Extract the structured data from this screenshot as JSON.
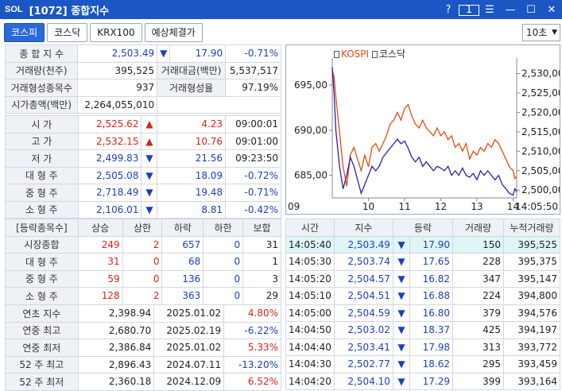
{
  "window": {
    "logo": "SOL",
    "title": "[1072] 종합지수",
    "help": "?",
    "box": "1"
  },
  "tabs": [
    "코스피",
    "코스닥",
    "KRX100",
    "예상체결가"
  ],
  "period": "10초",
  "summary": {
    "r1": {
      "label": "종 합 지 수",
      "value": "2,503.49",
      "arrow": "▼",
      "change": "17.90",
      "pct": "-0.71%"
    },
    "r2": {
      "label": "거래량(천주)",
      "value": "395,525",
      "label2": "거래대금(백만)",
      "value2": "5,537,517"
    },
    "r3": {
      "label": "거래형성종목수",
      "value": "937",
      "label2": "거래형성율",
      "value2": "97.19%"
    },
    "r4": {
      "label": "시가총액(백만)",
      "value": "2,264,055,010"
    }
  },
  "prices": [
    {
      "label": "시      가",
      "value": "2,525.62",
      "arrow": "▲",
      "change": "4.23",
      "extra": "09:00:01"
    },
    {
      "label": "고      가",
      "value": "2,532.15",
      "arrow": "▲",
      "change": "10.76",
      "extra": "09:01:00"
    },
    {
      "label": "저      가",
      "value": "2,499.83",
      "arrow": "▼",
      "change": "21.56",
      "extra": "09:23:50"
    },
    {
      "label": "대 형 주",
      "value": "2,505.08",
      "arrow": "▼",
      "change": "18.09",
      "extra": "-0.72%"
    },
    {
      "label": "중 형 주",
      "value": "2,718.49",
      "arrow": "▼",
      "change": "19.48",
      "extra": "-0.71%"
    },
    {
      "label": "소 형 주",
      "value": "2,106.01",
      "arrow": "▼",
      "change": "8.81",
      "extra": "-0.42%"
    }
  ],
  "breadth": {
    "headers": [
      "[등락종목수]",
      "상승",
      "상한",
      "하락",
      "하한",
      "보합"
    ],
    "rows": [
      [
        "시장종합",
        "249",
        "2",
        "657",
        "0",
        "31"
      ],
      [
        "대 형 주",
        "31",
        "0",
        "68",
        "0",
        "1"
      ],
      [
        "중 형 주",
        "59",
        "0",
        "136",
        "0",
        "3"
      ],
      [
        "소 형 주",
        "128",
        "2",
        "363",
        "0",
        "29"
      ]
    ]
  },
  "yearly": [
    {
      "label": "연초  지수",
      "value": "2,398.94",
      "date": "2025.01.02",
      "pct": "4.80%"
    },
    {
      "label": "연중  최고",
      "value": "2,680.70",
      "date": "2025.02.19",
      "pct": "-6.22%"
    },
    {
      "label": "연중  최저",
      "value": "2,386.84",
      "date": "2025.01.02",
      "pct": "5.33%"
    },
    {
      "label": "52 주 최고",
      "value": "2,896.43",
      "date": "2024.07.11",
      "pct": "-13.20%"
    },
    {
      "label": "52 주 최저",
      "value": "2,360.18",
      "date": "2024.12.09",
      "pct": "6.52%"
    }
  ],
  "ticks": {
    "headers": [
      "시간",
      "지수",
      "등락",
      "거래량",
      "누적거래량"
    ],
    "rows": [
      [
        "14:05:40",
        "2,503.49",
        "▼",
        "17.90",
        "150",
        "395,525"
      ],
      [
        "14:05:30",
        "2,503.74",
        "▼",
        "17.65",
        "228",
        "395,375"
      ],
      [
        "14:05:20",
        "2,504.57",
        "▼",
        "16.82",
        "347",
        "395,147"
      ],
      [
        "14:05:10",
        "2,504.51",
        "▼",
        "16.88",
        "224",
        "394,800"
      ],
      [
        "14:05:00",
        "2,504.59",
        "▼",
        "16.80",
        "379",
        "394,576"
      ],
      [
        "14:04:50",
        "2,503.02",
        "▼",
        "18.37",
        "425",
        "394,197"
      ],
      [
        "14:04:40",
        "2,503.41",
        "▼",
        "17.98",
        "313",
        "393,772"
      ],
      [
        "14:04:30",
        "2,502.77",
        "▼",
        "18.62",
        "295",
        "393,459"
      ],
      [
        "14:04:20",
        "2,504.10",
        "▼",
        "17.29",
        "399",
        "393,164"
      ]
    ]
  },
  "chart_data": {
    "type": "line",
    "legend": [
      "KOSPI",
      "코스닥"
    ],
    "x_ticks": [
      "09",
      "10",
      "11",
      "12",
      "13",
      "14",
      "14:05:50"
    ],
    "left_axis": {
      "ticks": [
        "695,00",
        "690,00",
        "685,00"
      ],
      "range": [
        682.5,
        698.0
      ]
    },
    "right_axis": {
      "ticks": [
        "2,530,00",
        "2,525,00",
        "2,520,00",
        "2,515,00",
        "2,510,00",
        "2,505,00",
        "2,500,00"
      ],
      "range": [
        2498.0,
        2534.0
      ]
    },
    "series": [
      {
        "name": "KOSPI",
        "axis": "right",
        "color": "#e84b10",
        "x": [
          9.0,
          9.05,
          9.1,
          9.2,
          9.3,
          9.4,
          9.5,
          9.6,
          9.7,
          9.8,
          9.9,
          10.0,
          10.1,
          10.2,
          10.3,
          10.4,
          10.5,
          10.6,
          10.7,
          10.8,
          10.9,
          11.0,
          11.1,
          11.2,
          11.3,
          11.4,
          11.5,
          11.6,
          11.7,
          11.8,
          11.9,
          12.0,
          12.1,
          12.2,
          12.3,
          12.4,
          12.5,
          12.6,
          12.7,
          12.8,
          12.9,
          13.0,
          13.1,
          13.2,
          13.3,
          13.4,
          13.5,
          13.6,
          13.7,
          13.8,
          13.9,
          14.0,
          14.05,
          14.1
        ],
        "values": [
          2531,
          2529,
          2524,
          2515,
          2506,
          2501,
          2509,
          2511,
          2508,
          2505,
          2509,
          2506,
          2511,
          2512,
          2510,
          2512,
          2514,
          2517,
          2518,
          2520,
          2518,
          2521,
          2522,
          2519,
          2517,
          2516,
          2518,
          2516,
          2515,
          2514,
          2516,
          2514,
          2515,
          2513,
          2514,
          2511,
          2512,
          2510,
          2512,
          2508,
          2510,
          2509,
          2511,
          2510,
          2512,
          2511,
          2513,
          2512,
          2510,
          2508,
          2506,
          2505,
          2503,
          2503.5
        ]
      },
      {
        "name": "코스닥",
        "axis": "left",
        "color": "#2a1fb0",
        "x": [
          9.0,
          9.05,
          9.1,
          9.2,
          9.3,
          9.4,
          9.5,
          9.6,
          9.7,
          9.8,
          9.9,
          10.0,
          10.1,
          10.2,
          10.3,
          10.4,
          10.5,
          10.6,
          10.7,
          10.8,
          10.9,
          11.0,
          11.1,
          11.2,
          11.3,
          11.4,
          11.5,
          11.6,
          11.7,
          11.8,
          11.9,
          12.0,
          12.1,
          12.2,
          12.3,
          12.4,
          12.5,
          12.6,
          12.7,
          12.8,
          12.9,
          13.0,
          13.1,
          13.2,
          13.3,
          13.4,
          13.5,
          13.6,
          13.7,
          13.8,
          13.9,
          14.0,
          14.05,
          14.1
        ],
        "values": [
          697,
          694,
          690,
          686,
          683.5,
          685,
          687,
          686,
          684.5,
          683,
          684,
          685,
          686,
          685.5,
          686,
          687,
          687.5,
          688,
          688.5,
          689,
          688.5,
          688.8,
          688,
          687,
          686.5,
          687,
          686,
          686.5,
          686,
          685.5,
          686,
          685.8,
          685.5,
          686,
          685,
          685.5,
          685,
          685.8,
          685,
          684.8,
          685.2,
          684.5,
          685.5,
          685,
          685.5,
          685,
          684.5,
          685,
          684,
          683.5,
          683,
          682.8,
          683.5,
          683.2
        ]
      }
    ]
  }
}
